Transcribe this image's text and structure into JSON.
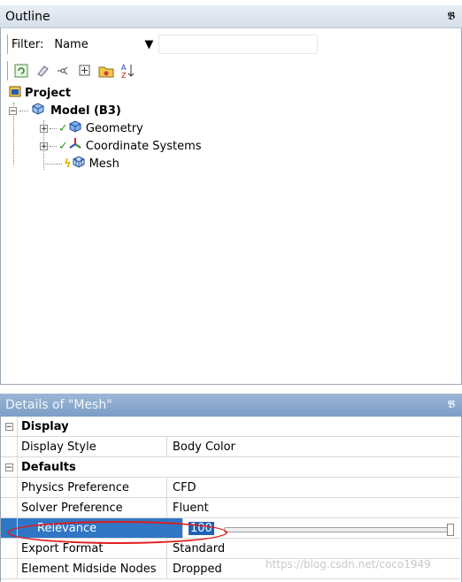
{
  "outline": {
    "title": "Outline",
    "pin": "ᵖ",
    "filter_label": "Filter:",
    "filter_value": "Name",
    "filter_text": "",
    "tree": {
      "project": "Project",
      "model": "Model (B3)",
      "geometry": "Geometry",
      "coordinate_systems": "Coordinate Systems",
      "mesh": "Mesh"
    }
  },
  "details": {
    "title": "Details of \"Mesh\"",
    "pin": "ᵖ",
    "rows": [
      {
        "type": "group",
        "label": "Display"
      },
      {
        "type": "prop",
        "label": "Display Style",
        "value": "Body Color"
      },
      {
        "type": "group",
        "label": "Defaults"
      },
      {
        "type": "prop",
        "label": "Physics Preference",
        "value": "CFD"
      },
      {
        "type": "prop",
        "label": "Solver Preference",
        "value": "Fluent"
      },
      {
        "type": "slider",
        "label": "Relevance",
        "value": "100"
      },
      {
        "type": "prop",
        "label": "Export Format",
        "value": "Standard"
      },
      {
        "type": "prop",
        "label": "Element Midside Nodes",
        "value": "Dropped"
      }
    ]
  },
  "watermark": "https://blog.csdn.net/coco1949",
  "colors": {
    "selection": "#2f76c5",
    "annotation": "#e01c1c",
    "header": "#7d9dc6"
  }
}
